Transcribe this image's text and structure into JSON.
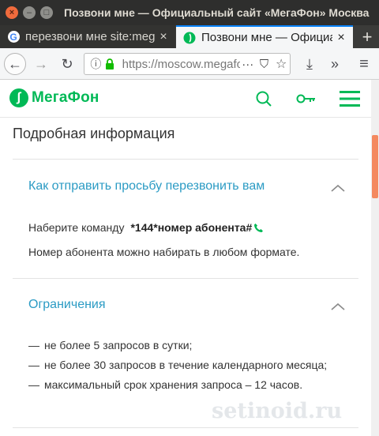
{
  "window": {
    "title": "Позвони мне — Официальный сайт «МегаФон» Москва",
    "controls": {
      "close": "×",
      "minimize": "–",
      "maximize": "□"
    }
  },
  "tabs": [
    {
      "label": "перезвони мне site:megafon.ru",
      "icon": "google-favicon-icon",
      "icon_glyph": "G",
      "close": "×",
      "active": false
    },
    {
      "label": "Позвони мне — Официальный сайт «МегаФон»",
      "icon": "megafon-favicon-icon",
      "close": "×",
      "active": true
    }
  ],
  "new_tab": "+",
  "navbar": {
    "back": "←",
    "forward": "→",
    "reload": "↻",
    "info_glyph": "ⓘ",
    "url": "https://moscow.megafon.ru",
    "page_actions": "···",
    "pocket": "⛉",
    "bookmark": "☆",
    "download": "⤓",
    "overflow": "»",
    "menu": "≡"
  },
  "site": {
    "logo_text": "МегаФон",
    "logo_mark": "∫"
  },
  "content": {
    "section_title": "Подробная информация",
    "accordion1": {
      "title": "Как отправить просьбу перезвонить вам",
      "command_prefix": "Наберите команду",
      "command_code": "*144*номер абонента#",
      "note": "Номер абонента можно набирать в любом формате."
    },
    "accordion2": {
      "title": "Ограничения",
      "dash": "—",
      "items": [
        "не более 5 запросов в сутки;",
        "не более 30 запросов в течение календарного месяца;",
        "максимальный срок хранения запроса – 12 часов."
      ]
    }
  },
  "watermark": "setinoid.ru",
  "colors": {
    "brand_green": "#00b956",
    "link_blue": "#2b9bc4",
    "scroll_thumb": "#f4895f",
    "titlebar": "#2e2e2d"
  }
}
